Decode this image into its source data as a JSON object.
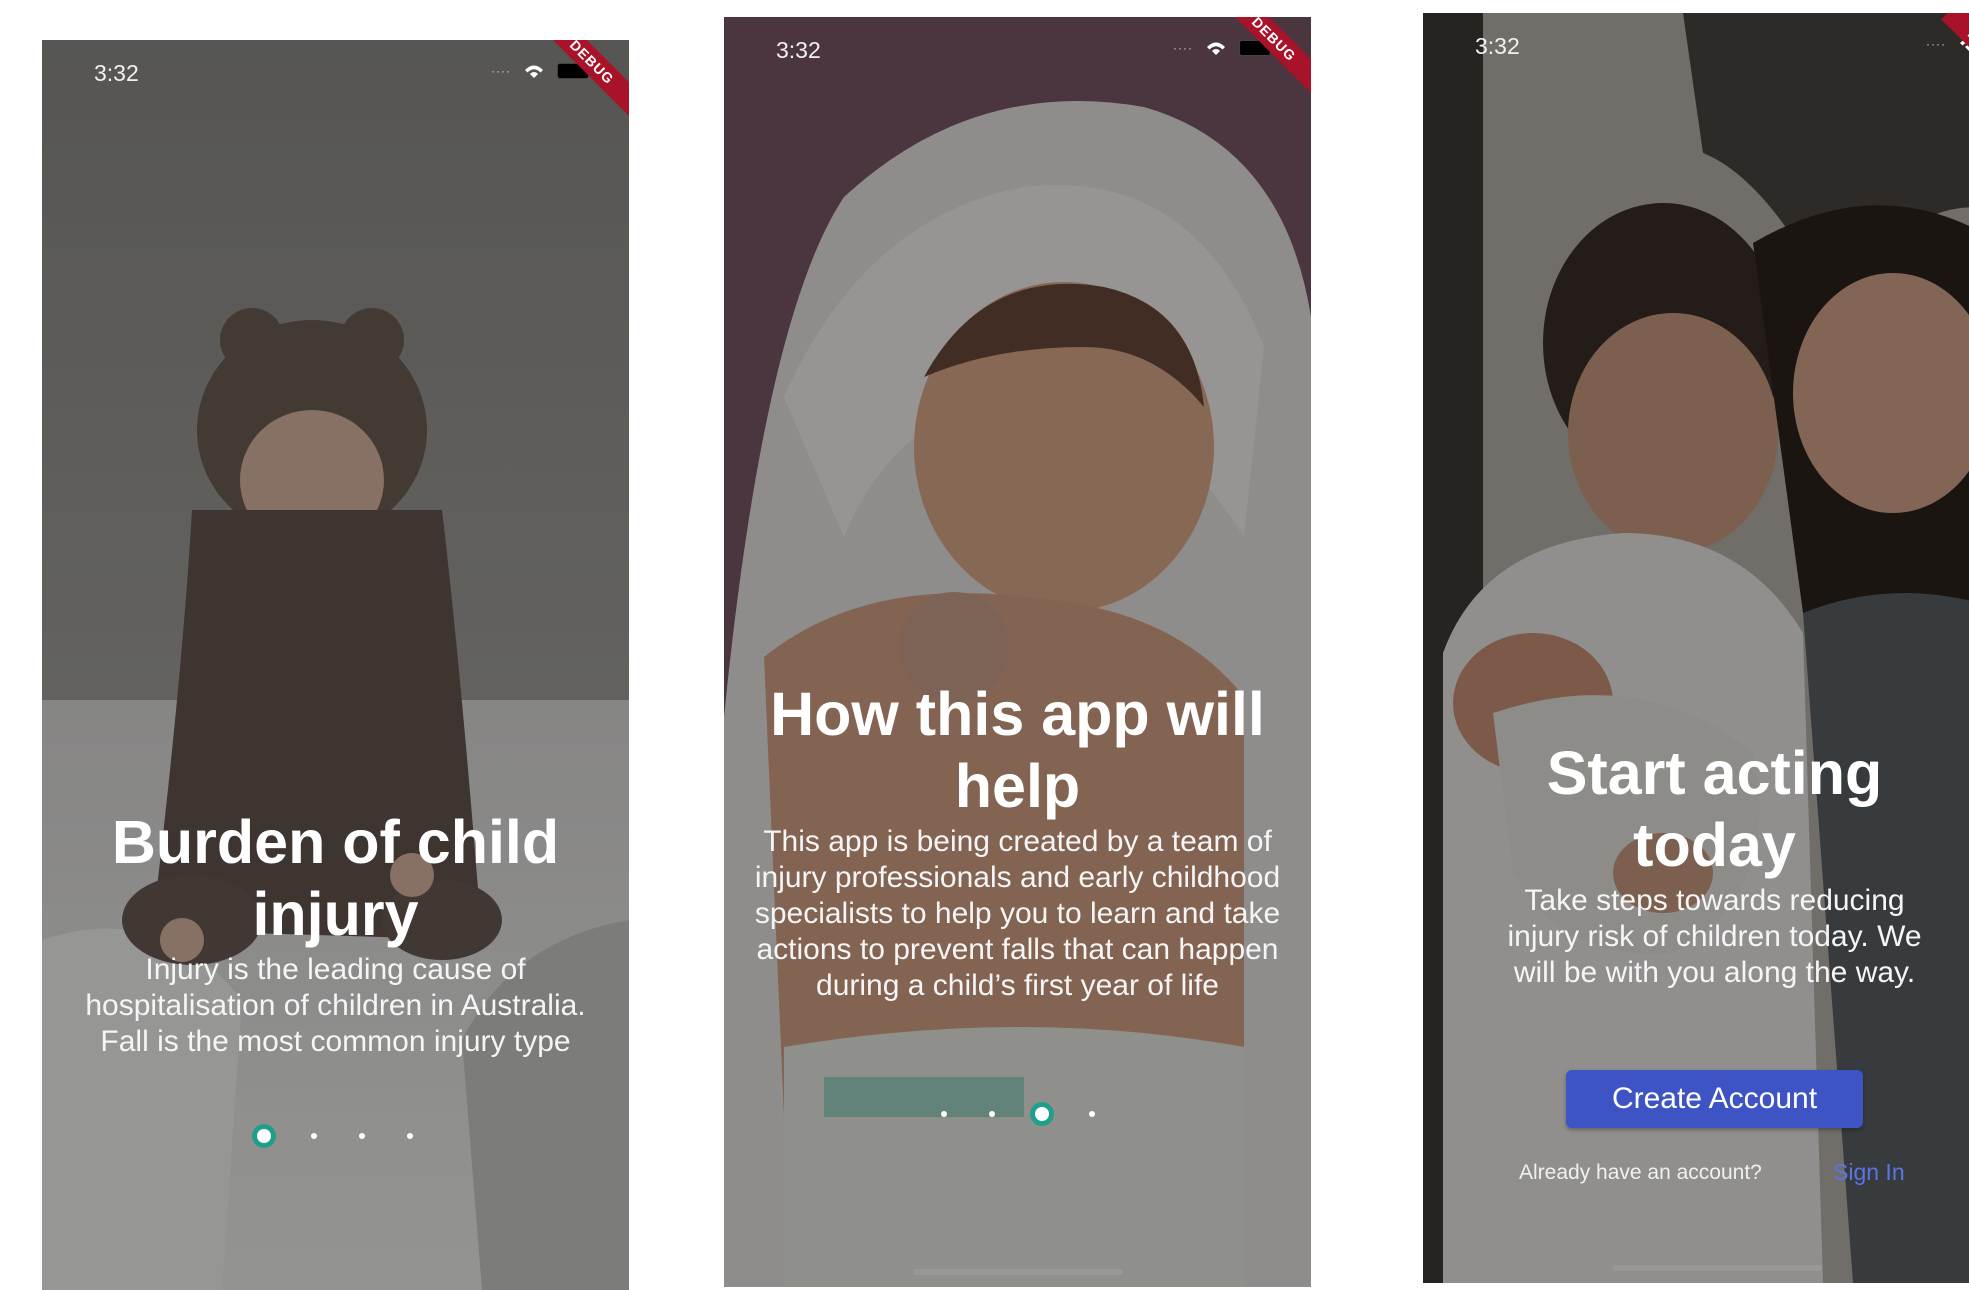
{
  "screens": [
    {
      "status": {
        "time": "3:32",
        "debug": "DEBUG"
      },
      "title": "Burden of child injury",
      "body": "Injury is the leading cause of hospitalisation of children in Australia. Fall is the most common injury type",
      "page_indicator": {
        "count": 4,
        "active_index": 0
      }
    },
    {
      "status": {
        "time": "3:32",
        "debug": "DEBUG"
      },
      "title": "How this app will help",
      "body": "This app is being created by a team of injury professionals and early childhood specialists to help you to learn and take actions to prevent falls that can happen during a child’s first year of life",
      "page_indicator": {
        "count": 4,
        "active_index": 2
      }
    },
    {
      "status": {
        "time": "3:32",
        "debug": "DE"
      },
      "title": "Start acting today",
      "body": "Take steps towards reducing injury risk of children today. We will be with you along the way.",
      "create_account_label": "Create Account",
      "signin_prompt": "Already have an account?",
      "signin_link": "Sign In"
    }
  ],
  "colors": {
    "active_dot_ring": "#20a08c",
    "primary_button": "#3f54c4",
    "link": "#5b74e8",
    "debug_ribbon": "#a8132a"
  },
  "icons": [
    "wifi-icon",
    "battery-icon"
  ]
}
